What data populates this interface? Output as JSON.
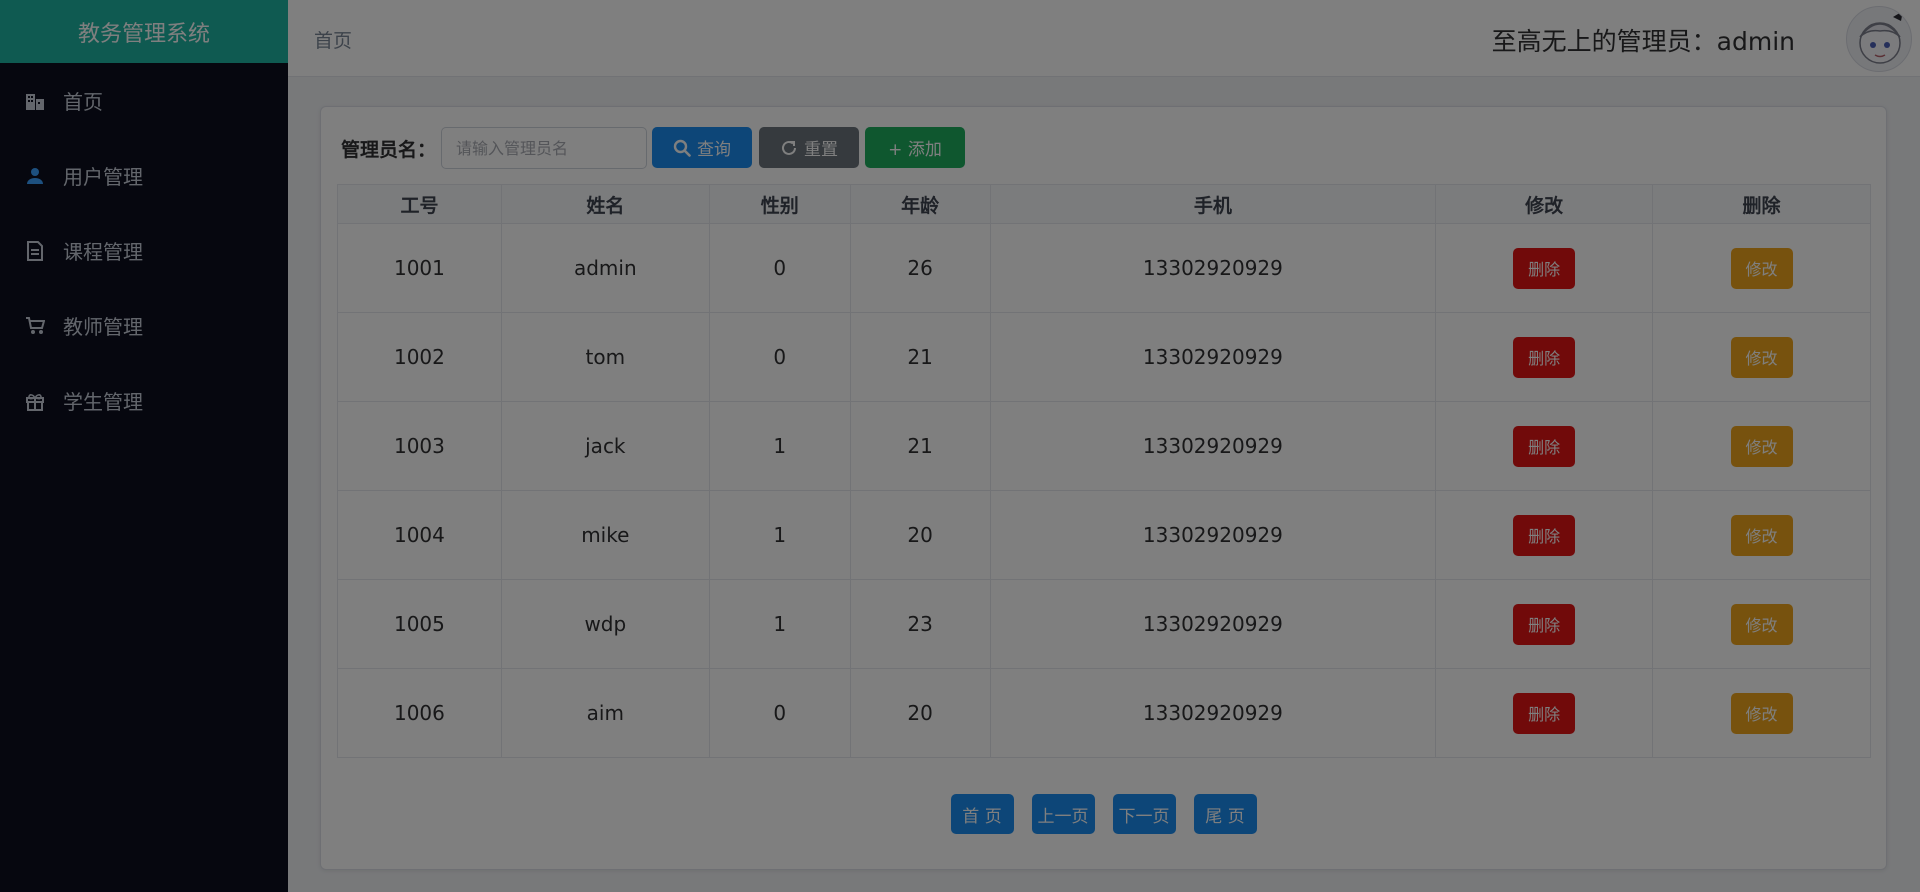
{
  "app": {
    "title": "教务管理系统"
  },
  "sidebar": {
    "items": [
      {
        "label": "首页",
        "icon": "building-icon"
      },
      {
        "label": "用户管理",
        "icon": "user-icon"
      },
      {
        "label": "课程管理",
        "icon": "document-icon"
      },
      {
        "label": "教师管理",
        "icon": "cart-icon"
      },
      {
        "label": "学生管理",
        "icon": "gift-icon"
      }
    ]
  },
  "header": {
    "breadcrumb": "首页",
    "admin_text": "至高无上的管理员：admin"
  },
  "search": {
    "label": "管理员名：",
    "placeholder": "请输入管理员名",
    "query_label": "查询",
    "reset_label": "重置",
    "add_label": "+ 添加"
  },
  "table": {
    "columns": [
      "工号",
      "姓名",
      "性别",
      "年龄",
      "手机",
      "修改",
      "删除"
    ],
    "rows": [
      {
        "id": "1001",
        "name": "admin",
        "gender": "0",
        "age": "26",
        "phone": "13302920929",
        "red_label": "删除",
        "yellow_label": "修改"
      },
      {
        "id": "1002",
        "name": "tom",
        "gender": "0",
        "age": "21",
        "phone": "13302920929",
        "red_label": "删除",
        "yellow_label": "修改"
      },
      {
        "id": "1003",
        "name": "jack",
        "gender": "1",
        "age": "21",
        "phone": "13302920929",
        "red_label": "删除",
        "yellow_label": "修改"
      },
      {
        "id": "1004",
        "name": "mike",
        "gender": "1",
        "age": "20",
        "phone": "13302920929",
        "red_label": "删除",
        "yellow_label": "修改"
      },
      {
        "id": "1005",
        "name": "wdp",
        "gender": "1",
        "age": "23",
        "phone": "13302920929",
        "red_label": "删除",
        "yellow_label": "修改"
      },
      {
        "id": "1006",
        "name": "aim",
        "gender": "0",
        "age": "20",
        "phone": "13302920929",
        "red_label": "删除",
        "yellow_label": "修改"
      }
    ]
  },
  "pagination": {
    "first": "首 页",
    "prev": "上一页",
    "next": "下一页",
    "last": "尾 页"
  },
  "colors": {
    "brand": "#1fb5a3",
    "sidebar_bg": "#0c0f1e",
    "primary": "#1a8cf0",
    "danger": "#e31414",
    "warning": "#efa51c",
    "success": "#1eae5f",
    "secondary": "#6c757d"
  }
}
